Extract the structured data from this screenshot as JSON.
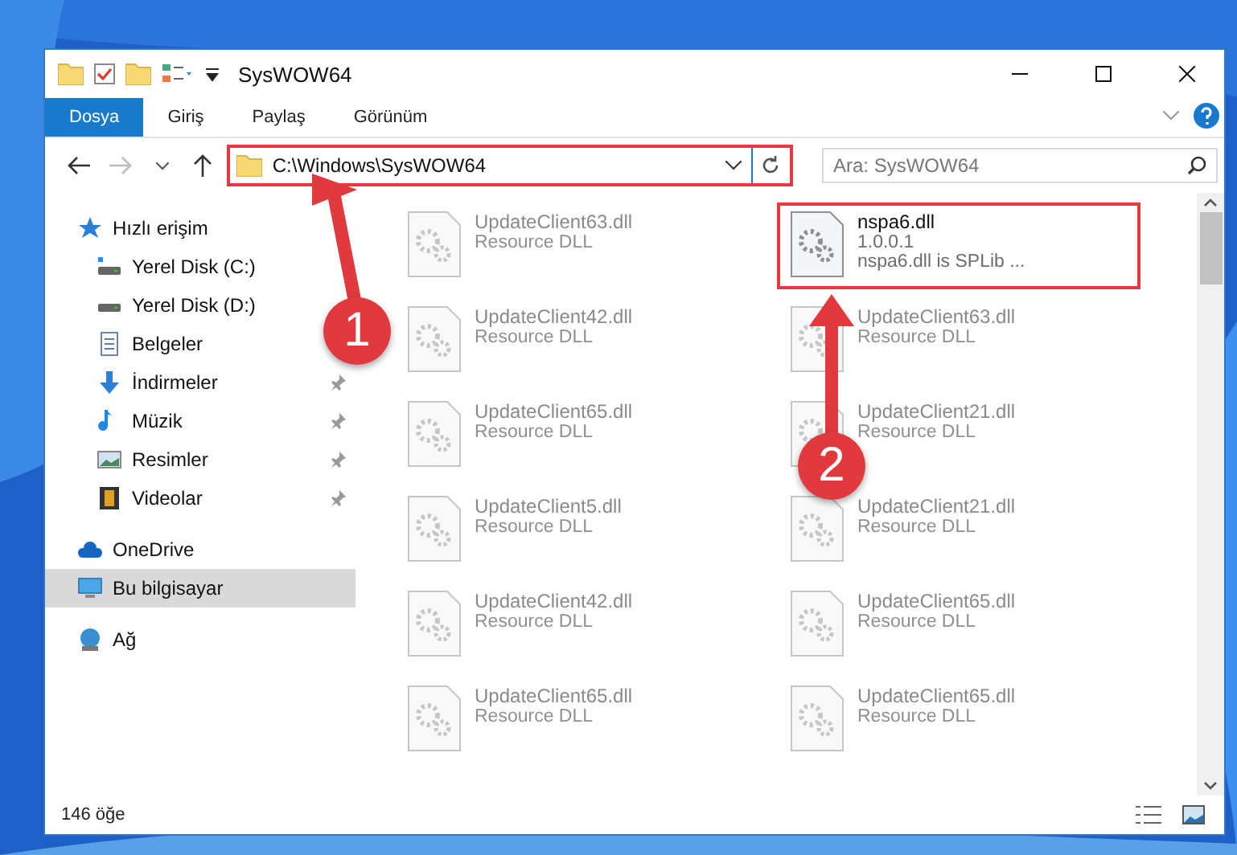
{
  "window": {
    "title": "SysWOW64"
  },
  "ribbon_tabs": [
    {
      "label": "Dosya",
      "selected": true
    },
    {
      "label": "Giriş",
      "selected": false
    },
    {
      "label": "Paylaş",
      "selected": false
    },
    {
      "label": "Görünüm",
      "selected": false
    }
  ],
  "address": {
    "path": "C:\\Windows\\SysWOW64",
    "highlighted": true
  },
  "search": {
    "placeholder": "Ara: SysWOW64"
  },
  "nav": [
    {
      "label": "Hızlı erişim",
      "kind": "quick",
      "pinned": false,
      "selected": false
    },
    {
      "label": "Yerel Disk (C:)",
      "kind": "system-drive",
      "pinned": false,
      "selected": false
    },
    {
      "label": "Yerel Disk (D:)",
      "kind": "drive",
      "pinned": false,
      "selected": false
    },
    {
      "label": "Belgeler",
      "kind": "documents",
      "pinned": false,
      "selected": false
    },
    {
      "label": "İndirmeler",
      "kind": "downloads",
      "pinned": true,
      "selected": false
    },
    {
      "label": "Müzik",
      "kind": "music",
      "pinned": true,
      "selected": false
    },
    {
      "label": "Resimler",
      "kind": "pictures",
      "pinned": true,
      "selected": false
    },
    {
      "label": "Videolar",
      "kind": "videos",
      "pinned": true,
      "selected": false
    },
    {
      "label": "OneDrive",
      "kind": "cloud",
      "pinned": false,
      "selected": false
    },
    {
      "label": "Bu bilgisayar",
      "kind": "computer",
      "pinned": false,
      "selected": true
    },
    {
      "label": "Ağ",
      "kind": "network",
      "pinned": false,
      "selected": false
    }
  ],
  "files": [
    {
      "name": "UpdateClient63.dll",
      "details": [
        "Resource DLL"
      ],
      "blurred": true,
      "highlighted": false
    },
    {
      "name": "nspa6.dll",
      "details": [
        "1.0.0.1",
        "nspa6.dll is SPLib ..."
      ],
      "blurred": false,
      "highlighted": true
    },
    {
      "name": "UpdateClient42.dll",
      "details": [
        "Resource DLL"
      ],
      "blurred": true,
      "highlighted": false
    },
    {
      "name": "UpdateClient63.dll",
      "details": [
        "Resource DLL"
      ],
      "blurred": true,
      "highlighted": false
    },
    {
      "name": "UpdateClient65.dll",
      "details": [
        "Resource DLL"
      ],
      "blurred": true,
      "highlighted": false
    },
    {
      "name": "UpdateClient21.dll",
      "details": [
        "Resource DLL"
      ],
      "blurred": true,
      "highlighted": false
    },
    {
      "name": "UpdateClient5.dll",
      "details": [
        "Resource DLL"
      ],
      "blurred": true,
      "highlighted": false
    },
    {
      "name": "UpdateClient21.dll",
      "details": [
        "Resource DLL"
      ],
      "blurred": true,
      "highlighted": false
    },
    {
      "name": "UpdateClient42.dll",
      "details": [
        "Resource DLL"
      ],
      "blurred": true,
      "highlighted": false
    },
    {
      "name": "UpdateClient65.dll",
      "details": [
        "Resource DLL"
      ],
      "blurred": true,
      "highlighted": false
    },
    {
      "name": "UpdateClient65.dll",
      "details": [
        "Resource DLL"
      ],
      "blurred": true,
      "highlighted": false
    },
    {
      "name": "UpdateClient65.dll",
      "details": [
        "Resource DLL"
      ],
      "blurred": true,
      "highlighted": false
    }
  ],
  "annotations": [
    {
      "label": "1"
    },
    {
      "label": "2"
    }
  ],
  "status_bar": {
    "count": "146 öğe"
  }
}
